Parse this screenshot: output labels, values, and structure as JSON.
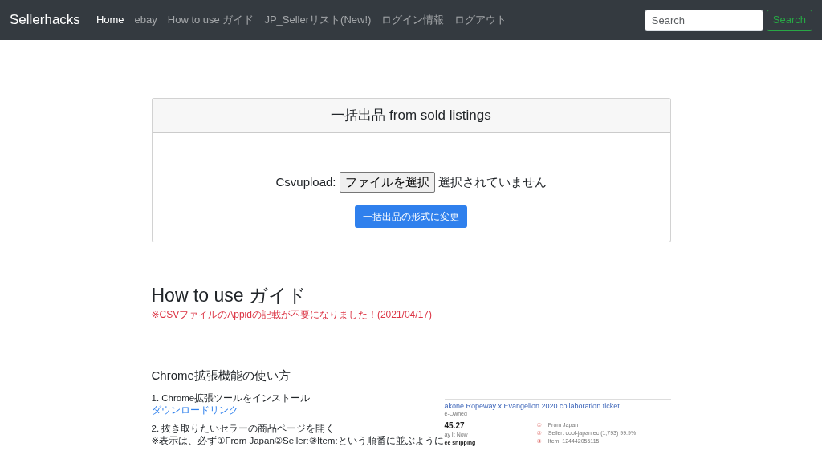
{
  "navbar": {
    "brand": "Sellerhacks",
    "links": [
      {
        "label": "Home",
        "selected": true
      },
      {
        "label": "ebay",
        "selected": false
      },
      {
        "label": "How to use ガイド",
        "selected": false
      },
      {
        "label": "JP_Sellerリスト(New!)",
        "selected": false
      },
      {
        "label": "ログイン情報",
        "selected": false
      },
      {
        "label": "ログアウト",
        "selected": false
      }
    ],
    "search": {
      "placeholder": "Search",
      "button": "Search"
    }
  },
  "upload_card": {
    "title": "一括出品 from sold listings",
    "field_label": "Csvupload:",
    "file_button": "ファイルを選択",
    "file_status": "選択されていません",
    "submit": "一括出品の形式に変更"
  },
  "guide": {
    "title": "How to use ガイド",
    "notice": "※CSVファイルのAppidの記載が不要になりました！(2021/04/17)",
    "section_title": "Chrome拡張機能の使い方",
    "steps": [
      {
        "text": "1. Chrome拡張ツールをインストール",
        "link": "ダウンロードリンク"
      },
      {
        "text": "2. 抜き取りたいセラーの商品ページを開く",
        "note": "※表示は、必ず①From Japan②Seller:③Item:という順番に並ぶように"
      }
    ],
    "screenshot": {
      "title": "akone Ropeway x Evangelion 2020 collaboration ticket",
      "condition": "e-Owned",
      "price": "45.27",
      "format": "ay It Now",
      "shipping": "ee shipping",
      "details": [
        {
          "number": "①",
          "text": "From Japan"
        },
        {
          "number": "②",
          "text": "Seller: cool-japan.ec (1,793) 99.9%"
        },
        {
          "number": "③",
          "text": "Item: 124442055115"
        }
      ]
    }
  }
}
